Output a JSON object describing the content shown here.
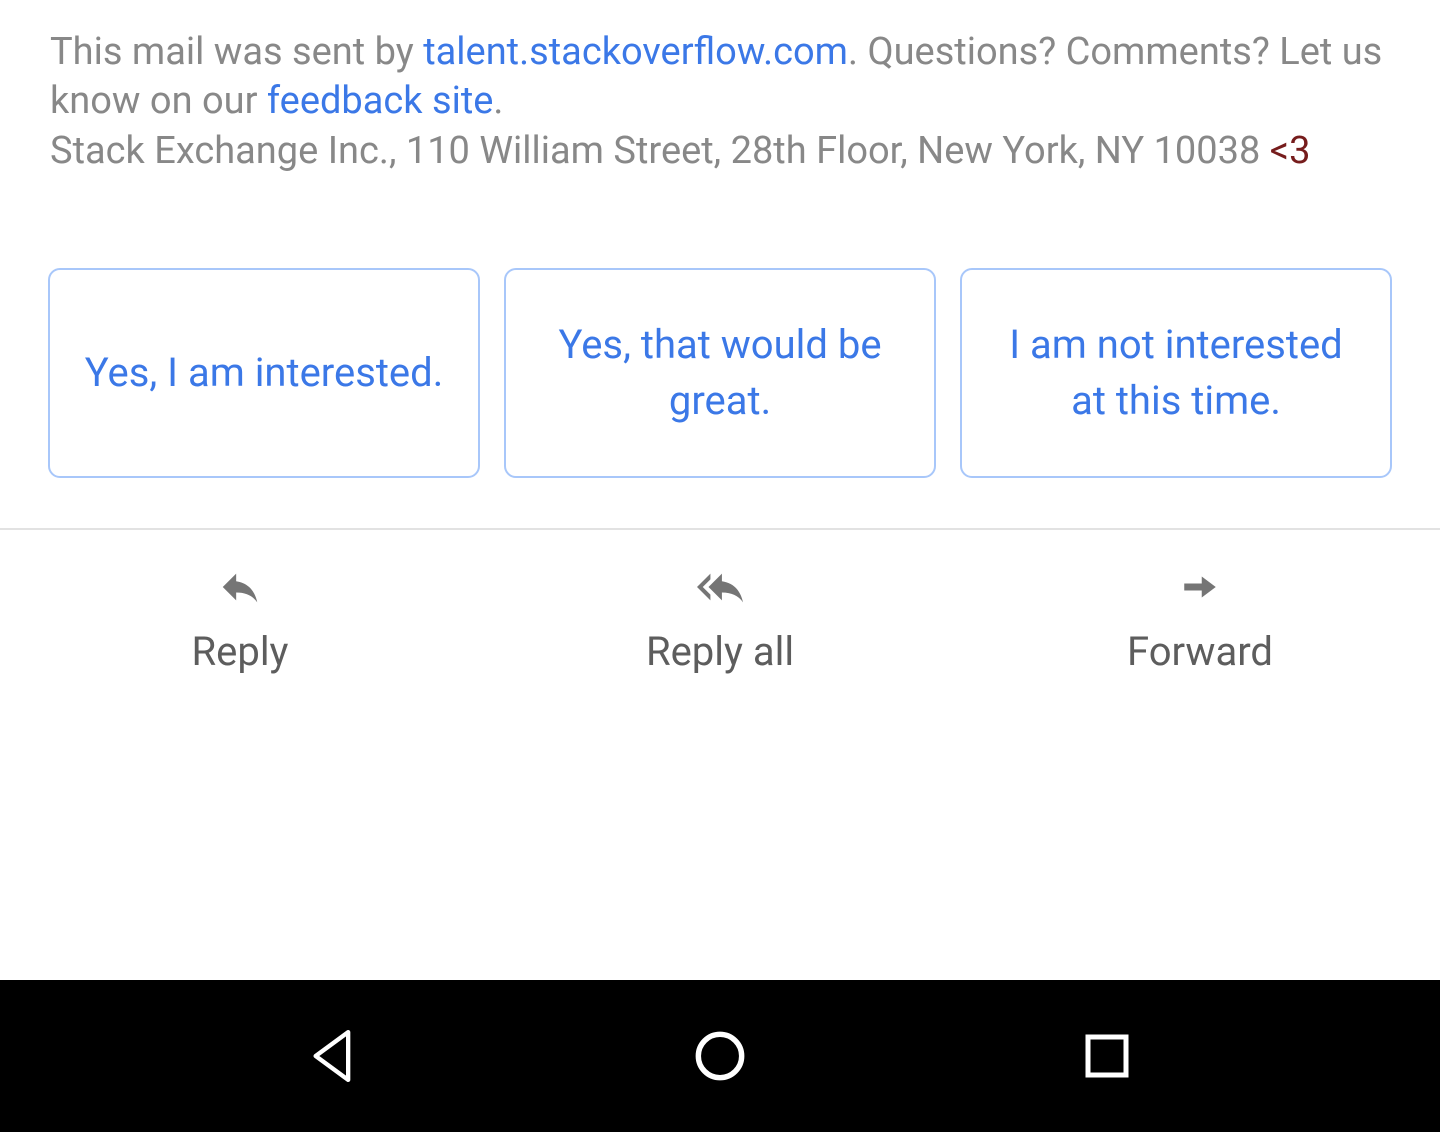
{
  "email": {
    "footer": {
      "part1": "This mail was sent by ",
      "link1": "talent.stackoverflow.com",
      "part2": ". Questions? Comments? Let us know on our ",
      "link2": "feedback site",
      "part3": ".",
      "address": "Stack Exchange Inc., 110 William Street, 28th Floor, New York, NY 10038 ",
      "heart": "<3"
    }
  },
  "suggestions": [
    "Yes, I am interested.",
    "Yes, that would be great.",
    "I am not interested at this time."
  ],
  "actions": {
    "reply": "Reply",
    "reply_all": "Reply all",
    "forward": "Forward"
  },
  "colors": {
    "link": "#3b78e7",
    "muted_text": "#888888",
    "heart": "#761c1c",
    "chip_border": "#a8c7fa",
    "icon": "#757575"
  }
}
